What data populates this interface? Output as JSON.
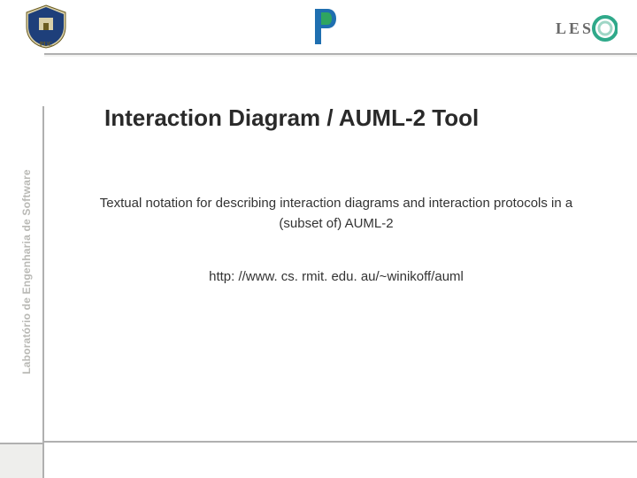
{
  "sidebar": {
    "label": "Laboratório de Engenharia de Software"
  },
  "content": {
    "title": "Interaction Diagram / AUML-2 Tool",
    "description": "Textual notation for describing interaction diagrams and interaction protocols in a (subset of) AUML-2",
    "url": "http: //www. cs. rmit. edu. au/~winikoff/auml"
  },
  "logos": {
    "left_alt": "PUC-Rio crest",
    "mid_alt": "Stylized P mark",
    "right_alt": "LES logo"
  }
}
